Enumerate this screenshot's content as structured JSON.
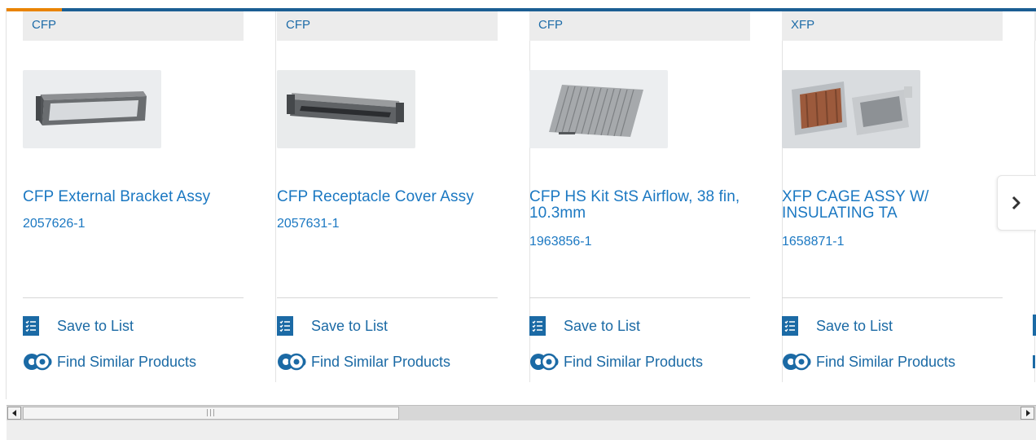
{
  "products": [
    {
      "category": "CFP",
      "image_icon": "cfp-external-bracket-image",
      "title": "CFP External Bracket Assy",
      "part_number": "2057626-1",
      "save_label": "Save to List",
      "similar_label": "Find Similar Products"
    },
    {
      "category": "CFP",
      "image_icon": "cfp-receptacle-cover-image",
      "title": "CFP Receptacle Cover Assy",
      "part_number": "2057631-1",
      "save_label": "Save to List",
      "similar_label": "Find Similar Products"
    },
    {
      "category": "CFP",
      "image_icon": "cfp-heatsink-kit-image",
      "title": "CFP HS Kit StS Airflow, 38 fin, 10.3mm",
      "part_number": "1963856-1",
      "save_label": "Save to List",
      "similar_label": "Find Similar Products"
    },
    {
      "category": "XFP",
      "image_icon": "xfp-cage-assy-image",
      "title": "XFP CAGE ASSY W/ INSULATING TA",
      "part_number": "1658871-1",
      "save_label": "Save to List",
      "similar_label": "Find Similar Products"
    }
  ],
  "carousel": {
    "next_icon": "chevron-right-icon"
  },
  "colors": {
    "link_blue": "#1b78c2",
    "icon_blue": "#1b6aa5",
    "accent_orange": "#e98300",
    "accent_blue": "#1b5e93",
    "category_bg": "#ececec"
  }
}
